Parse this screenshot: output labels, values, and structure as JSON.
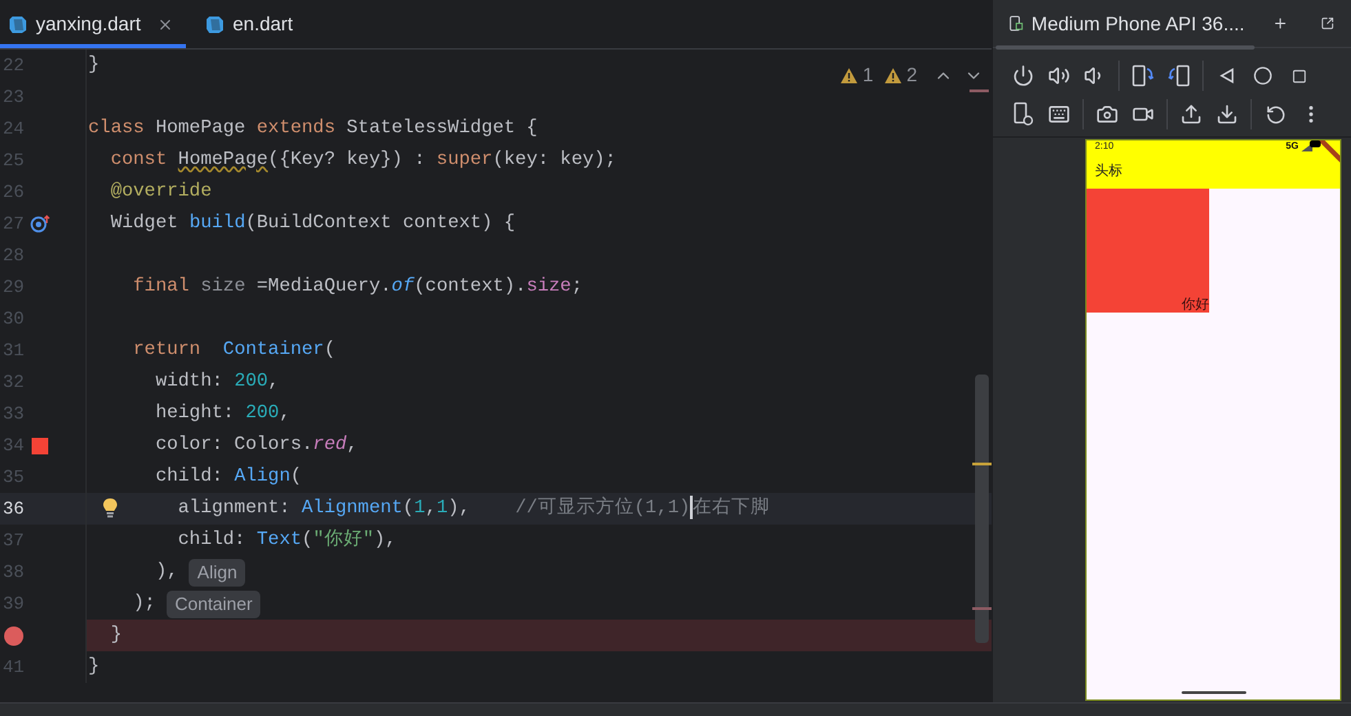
{
  "editor_tabs": [
    {
      "label": "yanxing.dart",
      "selected": true,
      "closable": true
    },
    {
      "label": "en.dart",
      "selected": false,
      "closable": false
    }
  ],
  "inspections": [
    "1",
    "2"
  ],
  "lines": [
    {
      "number": "22",
      "current": false,
      "breakpoint": false,
      "segments": [
        {
          "text": "}",
          "kind": "plain"
        }
      ]
    },
    {
      "number": "23",
      "current": false,
      "breakpoint": false
    },
    {
      "number": "24",
      "current": false,
      "breakpoint": false,
      "segments": [
        {
          "text": "class",
          "kind": "keyword"
        },
        {
          "text": " HomePage ",
          "kind": "plain"
        },
        {
          "text": "extends",
          "kind": "keyword"
        },
        {
          "text": " StatelessWidget {",
          "kind": "plain"
        }
      ]
    },
    {
      "number": "25",
      "current": false,
      "breakpoint": false,
      "segments": [
        {
          "text": "  const ",
          "kind": "keyword"
        },
        {
          "text": "HomePage",
          "kind": "warn"
        },
        {
          "text": "({Key? key}) : ",
          "kind": "plain"
        },
        {
          "text": "super",
          "kind": "keyword"
        },
        {
          "text": "(key: key);",
          "kind": "plain"
        }
      ]
    },
    {
      "number": "26",
      "current": false,
      "breakpoint": false,
      "segments": [
        {
          "text": "  @override",
          "kind": "annotation"
        }
      ]
    },
    {
      "number": "27",
      "current": false,
      "breakpoint": false,
      "gutter": {
        "kind": "override"
      },
      "segments": [
        {
          "text": "  Widget ",
          "kind": "plain"
        },
        {
          "text": "build",
          "kind": "fn"
        },
        {
          "text": "(BuildContext context) {",
          "kind": "plain"
        }
      ]
    },
    {
      "number": "28",
      "current": false,
      "breakpoint": false
    },
    {
      "number": "29",
      "current": false,
      "breakpoint": false,
      "segments": [
        {
          "text": "    final ",
          "kind": "keyword"
        },
        {
          "text": "size",
          "kind": "unused"
        },
        {
          "text": " =MediaQuery.",
          "kind": "plain"
        },
        {
          "text": "of",
          "kind": "fn_italic"
        },
        {
          "text": "(context).",
          "kind": "plain"
        },
        {
          "text": "size",
          "kind": "prop"
        },
        {
          "text": ";",
          "kind": "plain"
        }
      ]
    },
    {
      "number": "30",
      "current": false,
      "breakpoint": false
    },
    {
      "number": "31",
      "current": false,
      "breakpoint": false,
      "segments": [
        {
          "text": "    return  ",
          "kind": "keyword"
        },
        {
          "text": "Container",
          "kind": "fn"
        },
        {
          "text": "(",
          "kind": "plain"
        }
      ]
    },
    {
      "number": "32",
      "current": false,
      "breakpoint": false,
      "segments": [
        {
          "text": "      width: ",
          "kind": "plain"
        },
        {
          "text": "200",
          "kind": "number"
        },
        {
          "text": ",",
          "kind": "plain"
        }
      ]
    },
    {
      "number": "33",
      "current": false,
      "breakpoint": false,
      "segments": [
        {
          "text": "      height: ",
          "kind": "plain"
        },
        {
          "text": "200",
          "kind": "number"
        },
        {
          "text": ",",
          "kind": "plain"
        }
      ]
    },
    {
      "number": "34",
      "current": false,
      "breakpoint": false,
      "gutter": {
        "kind": "color_swatch"
      },
      "segments": [
        {
          "text": "      color: Colors.",
          "kind": "plain"
        },
        {
          "text": "red",
          "kind": "prop_italic"
        },
        {
          "text": ",",
          "kind": "plain"
        }
      ]
    },
    {
      "number": "35",
      "current": false,
      "breakpoint": false,
      "segments": [
        {
          "text": "      child: ",
          "kind": "plain"
        },
        {
          "text": "Align",
          "kind": "fn"
        },
        {
          "text": "(",
          "kind": "plain"
        }
      ]
    },
    {
      "number": "36",
      "current": true,
      "breakpoint": false,
      "gutter": {
        "kind": "bulb"
      },
      "segments": [
        {
          "text": "        alignment: ",
          "kind": "plain"
        },
        {
          "text": "Alignment",
          "kind": "fn"
        },
        {
          "text": "(",
          "kind": "plain"
        },
        {
          "text": "1",
          "kind": "number"
        },
        {
          "text": ",",
          "kind": "plain"
        },
        {
          "text": "1",
          "kind": "number"
        },
        {
          "text": "),",
          "kind": "plain"
        },
        {
          "text": "    //可显示方位(1,1)",
          "kind": "comment"
        },
        {
          "text": "在右下脚",
          "kind": "comment",
          "caret_before": true
        }
      ]
    },
    {
      "number": "37",
      "current": false,
      "breakpoint": false,
      "segments": [
        {
          "text": "        child: ",
          "kind": "plain"
        },
        {
          "text": "Text",
          "kind": "fn"
        },
        {
          "text": "(",
          "kind": "plain"
        },
        {
          "text": "\"你好\"",
          "kind": "string"
        },
        {
          "text": "),",
          "kind": "plain"
        }
      ]
    },
    {
      "number": "38",
      "current": false,
      "breakpoint": false,
      "hint": "Align",
      "segments": [
        {
          "text": "      ),",
          "kind": "plain"
        }
      ]
    },
    {
      "number": "39",
      "current": false,
      "breakpoint": false,
      "hint": "Container",
      "segments": [
        {
          "text": "    );",
          "kind": "plain"
        }
      ]
    },
    {
      "current": false,
      "breakpoint": true,
      "segments": [
        {
          "text": "  }",
          "kind": "plain"
        }
      ]
    },
    {
      "number": "41",
      "current": false,
      "breakpoint": false,
      "segments": [
        {
          "text": "}",
          "kind": "plain"
        }
      ]
    }
  ],
  "device_panel": {
    "title": "Medium Phone API 36....",
    "screen": {
      "time": "2:10",
      "network": "5G",
      "app_bar_title": "头标",
      "box_text": "你好"
    }
  }
}
